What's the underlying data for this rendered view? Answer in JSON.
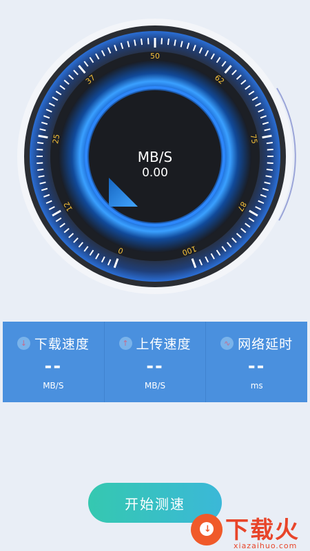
{
  "gauge": {
    "unit": "MB/S",
    "value": "0.00",
    "scale_labels": [
      "0",
      "12",
      "25",
      "37",
      "50",
      "62",
      "75",
      "87",
      "100"
    ],
    "accent_color": "#2b8cff",
    "label_color": "#f5c03a"
  },
  "stats": [
    {
      "icon": "download-icon",
      "glyph": "↓",
      "title": "下载速度",
      "value": "--",
      "unit": "MB/S"
    },
    {
      "icon": "upload-icon",
      "glyph": "↑",
      "title": "上传速度",
      "value": "--",
      "unit": "MB/S"
    },
    {
      "icon": "wave-icon",
      "glyph": "∿",
      "title": "网络延时",
      "value": "--",
      "unit": "ms"
    }
  ],
  "start_button": {
    "label": "开始测速"
  },
  "watermark": {
    "text": "下载火",
    "url": "xiazaihuo.com"
  }
}
